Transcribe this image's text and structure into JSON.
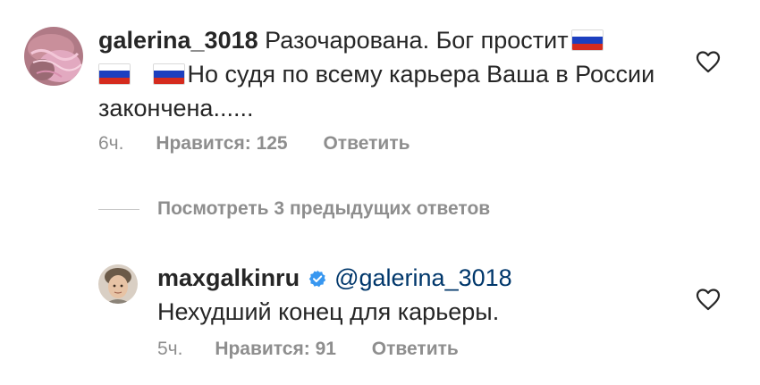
{
  "comment1": {
    "username": "galerina_3018",
    "text_part1": "Разочарована. Бог простит",
    "text_part2": "Но судя по всему карьера Ваша в России закончена......",
    "time": "6ч.",
    "likes": "Нравится: 125",
    "reply": "Ответить",
    "flag_icon": "russia-flag-icon"
  },
  "view_replies": {
    "label": "Посмотреть 3 предыдущих ответов"
  },
  "comment2": {
    "username": "maxgalkinru",
    "mention": "@galerina_3018",
    "text": "Нехудший конец для карьеры.",
    "time": "5ч.",
    "likes": "Нравится: 91",
    "reply": "Ответить",
    "verified_icon": "verified-badge-icon"
  },
  "colors": {
    "text": "#262626",
    "meta": "#8e8e8e",
    "mention": "#00376b",
    "verified": "#3897f0"
  }
}
